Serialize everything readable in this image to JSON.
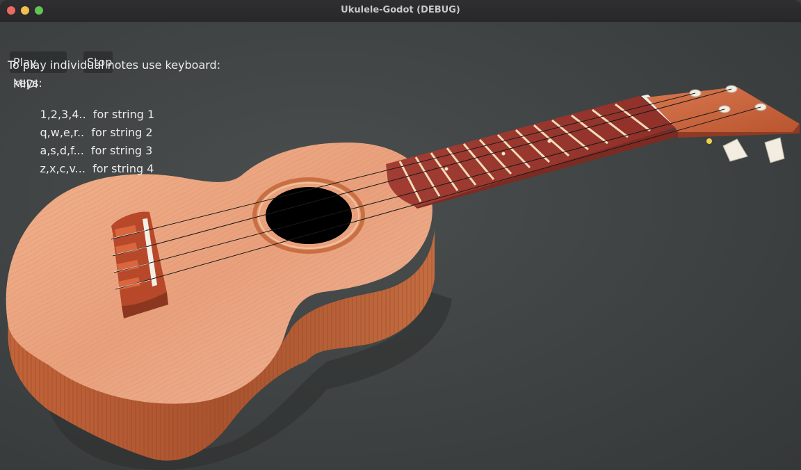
{
  "window": {
    "title": "Ukulele-Godot (DEBUG)",
    "controls": [
      "close",
      "minimize",
      "maximize"
    ]
  },
  "toolbar": {
    "play_label": "Play MIDI",
    "stop_label": "Stop"
  },
  "instructions": {
    "heading": "To play individual notes use keyboard:",
    "keys_label": "keys:",
    "lines": [
      {
        "keys": "1,2,3,4..",
        "text": "for string 1"
      },
      {
        "keys": "q,w,e,r..",
        "text": "for string 2"
      },
      {
        "keys": "a,s,d,f...",
        "text": "for string 3"
      },
      {
        "keys": "z,x,c,v...",
        "text": "for string 4"
      }
    ]
  },
  "scene": {
    "object": "ukulele-3d-model",
    "colors": {
      "background": "#3e4242",
      "body_wood": "#e8a27e",
      "side_wood": "#b55a30",
      "fretboard": "#9c3d32",
      "bridge": "#b44a2c",
      "frets": "#f0d9b5"
    }
  }
}
